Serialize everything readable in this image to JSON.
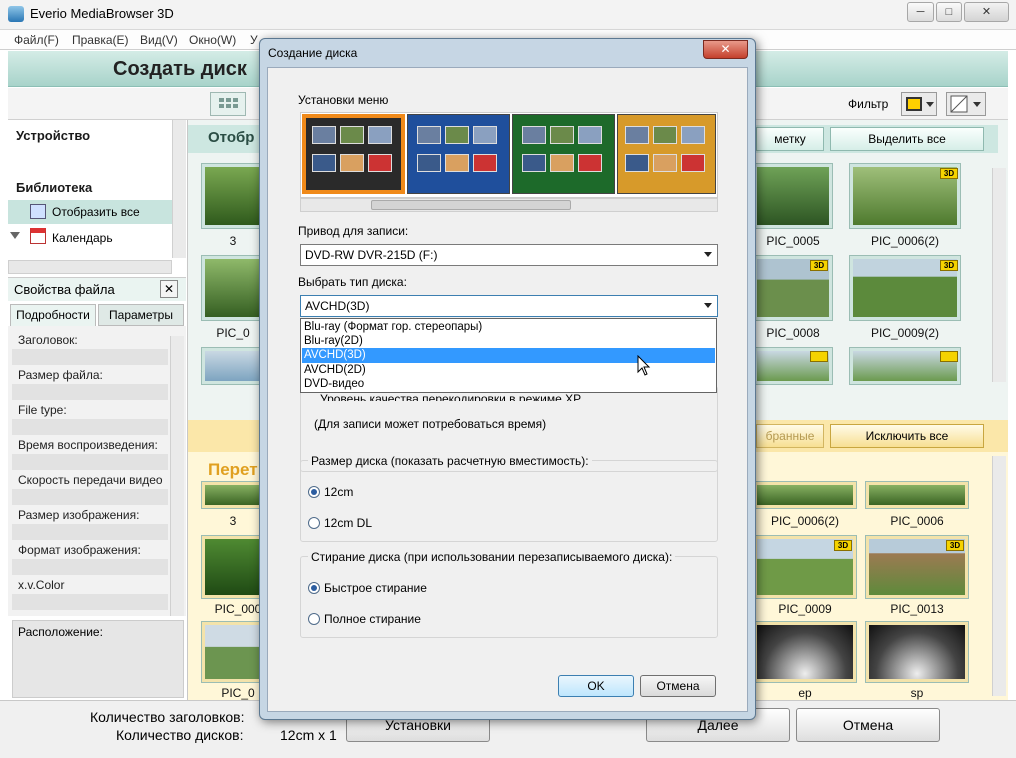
{
  "window": {
    "title": "Everio MediaBrowser 3D",
    "minimize_icon": "minimize-icon",
    "maximize_icon": "maximize-icon",
    "close_icon": "close-icon",
    "min_label": "─",
    "max_label": "□",
    "close_label": "✕"
  },
  "menu": [
    "Файл(F)",
    "Правка(E)",
    "Вид(V)",
    "Окно(W)",
    "У"
  ],
  "header": {
    "title": "Создать диск"
  },
  "toolbar": {
    "filter_label": "Фильтр"
  },
  "left_panel": {
    "device_heading": "Устройство",
    "library_heading": "Библиотека",
    "show_all": "Отобразить все",
    "calendar": "Календарь",
    "file_props_title": "Свойства файла",
    "close_symbol": "✕",
    "tabs": [
      "Подробности",
      "Параметры"
    ],
    "props": [
      "Заголовок:",
      "Размер файла:",
      "File type:",
      "Время воспроизведения:",
      "Скорость передачи видео",
      "Размер изображения:",
      "Формат изображения:",
      "x.v.Color"
    ],
    "location": "Расположение:"
  },
  "main_top": {
    "section_fragment": "Отобр",
    "btn_mark_fragment": "метку",
    "btn_select_all": "Выделить все",
    "thumbs_row1": [
      {
        "label": "3",
        "badge": ""
      },
      {
        "label": "PIC_0005",
        "badge": ""
      },
      {
        "label": "PIC_0006(2)",
        "badge": "3D"
      }
    ],
    "thumbs_row2": [
      {
        "label": "PIC_0",
        "badge": ""
      },
      {
        "label": "PIC_0008",
        "badge": "3D"
      },
      {
        "label": "PIC_0009(2)",
        "badge": "3D"
      }
    ]
  },
  "main_bottom": {
    "section_fragment": "Перет",
    "btn_favorites_fragment": "бранные",
    "btn_exclude_all": "Исключить все",
    "thumbs_row1": [
      {
        "label": "3"
      },
      {
        "label": "PIC_0006(2)"
      },
      {
        "label": "PIC_0006"
      }
    ],
    "thumbs_row2": [
      {
        "label": "PIC_000",
        "badge": ""
      },
      {
        "label": "PIC_0009",
        "badge": "3D"
      },
      {
        "label": "PIC_0013",
        "badge": "3D"
      }
    ],
    "thumbs_row3": [
      {
        "label": "PIC_0"
      },
      {
        "label": "ep"
      },
      {
        "label": "sp"
      }
    ]
  },
  "status": {
    "titles_label": "Количество заголовков:",
    "discs_label": "Количество дисков:",
    "discs_value": "12cm x 1",
    "settings_btn": "Установки",
    "next_btn": "Далее",
    "cancel_btn": "Отмена"
  },
  "dialog": {
    "title": "Создание диска",
    "menu_settings_label": "Установки меню",
    "drive_label": "Привод для записи:",
    "drive_value": "DVD-RW  DVR-215D (F:)",
    "disc_type_label": "Выбрать тип диска:",
    "disc_type_value": "AVCHD(3D)",
    "disc_type_options": [
      "Blu-ray (Формат гор. стереопары)",
      "Blu-ray(2D)",
      "AVCHD(3D)",
      "AVCHD(2D)",
      "DVD-видео"
    ],
    "disc_type_selected_index": 2,
    "hidden_option_fragment": "Уровень качества перекодировки в режиме XP",
    "time_note": "(Для записи может потребоваться время)",
    "disc_size_group": "Размер диска (показать расчетную вместимость):",
    "disc_size_options": [
      "12cm",
      "12cm DL"
    ],
    "disc_size_selected": 0,
    "erase_group": "Стирание диска (при использовании перезаписываемого диска):",
    "erase_options": [
      "Быстрое стирание",
      "Полное стирание"
    ],
    "erase_selected": 0,
    "ok_btn": "OK",
    "cancel_btn": "Отмена",
    "close_label": "✕",
    "themes": [
      {
        "name": "black-theme",
        "color": "#2a2a2a",
        "selected": true
      },
      {
        "name": "blue-theme",
        "color": "#1f4f9c",
        "selected": false
      },
      {
        "name": "green-theme",
        "color": "#1d6a2a",
        "selected": false
      },
      {
        "name": "orange-theme",
        "color": "#d79a2a",
        "selected": false
      }
    ]
  },
  "colors": {
    "accent_teal": "#a8d3ca",
    "selection_blue": "#3399ff",
    "theme_selected_border": "#f08a1a"
  }
}
